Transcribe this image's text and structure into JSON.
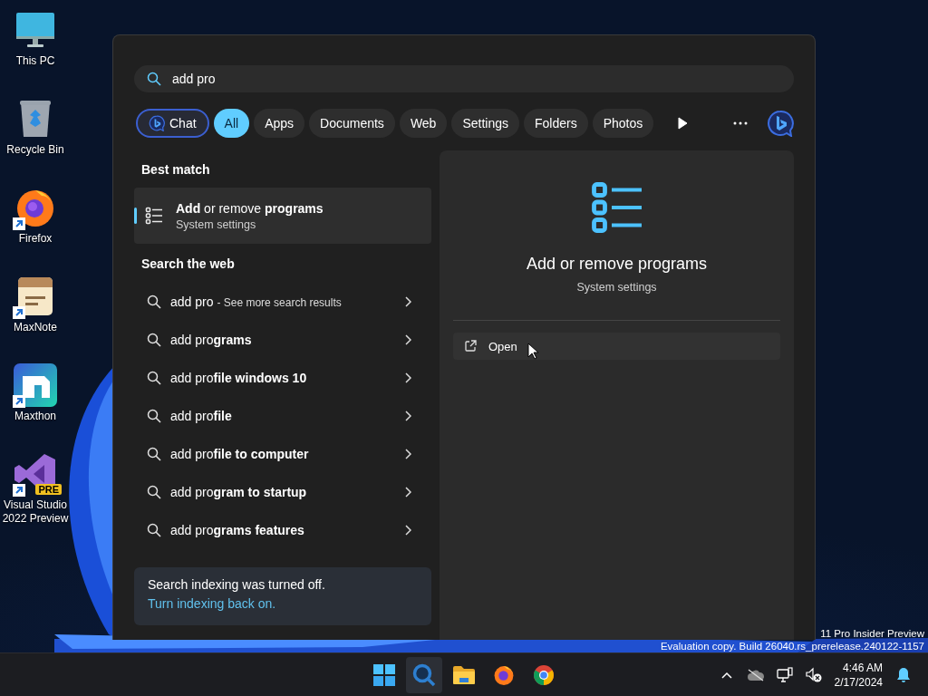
{
  "desktop": {
    "icons": [
      {
        "label": "This PC",
        "kind": "monitor",
        "shortcut": false
      },
      {
        "label": "Recycle Bin",
        "kind": "bin",
        "shortcut": false
      },
      {
        "label": "Firefox",
        "kind": "firefox",
        "shortcut": true
      },
      {
        "label": "MaxNote",
        "kind": "notepad",
        "shortcut": true
      },
      {
        "label": "Maxthon",
        "kind": "maxthon",
        "shortcut": true
      },
      {
        "label": "Visual Studio 2022 Preview",
        "kind": "vs",
        "shortcut": true,
        "badge": "PRE"
      }
    ],
    "watermark": [
      "11 Pro Insider Preview",
      "Evaluation copy. Build 26040.rs_prerelease.240122-1157"
    ]
  },
  "search": {
    "query": "add pro"
  },
  "filters": [
    {
      "label": "Chat",
      "kind": "chat",
      "selected": false
    },
    {
      "label": "All",
      "kind": "text",
      "selected": true
    },
    {
      "label": "Apps",
      "kind": "text",
      "selected": false
    },
    {
      "label": "Documents",
      "kind": "text",
      "selected": false
    },
    {
      "label": "Web",
      "kind": "text",
      "selected": false
    },
    {
      "label": "Settings",
      "kind": "text",
      "selected": false
    },
    {
      "label": "Folders",
      "kind": "text",
      "selected": false
    },
    {
      "label": "Photos",
      "kind": "text",
      "selected": false
    }
  ],
  "best_match": {
    "heading": "Best match",
    "title": "**Add** or remove **programs**",
    "subtitle": "System settings",
    "selected": true
  },
  "web": {
    "heading": "Search the web",
    "items": [
      {
        "text": "add pro",
        "hint": "- See more search results"
      },
      {
        "text": "add pro**grams**"
      },
      {
        "text": "add pro**file windows 10**"
      },
      {
        "text": "add pro**file**"
      },
      {
        "text": "add pro**file to computer**"
      },
      {
        "text": "add pro**gram to startup**"
      },
      {
        "text": "add pro**grams features**"
      }
    ]
  },
  "notice": {
    "text": "Search indexing was turned off.",
    "link": "Turn indexing back on."
  },
  "preview": {
    "title": "Add or remove programs",
    "subtitle": "System settings",
    "actions": [
      {
        "label": "Open"
      }
    ]
  },
  "taskbar": {
    "apps": [
      {
        "kind": "start",
        "active": false
      },
      {
        "kind": "search",
        "active": true
      },
      {
        "kind": "folder",
        "active": false
      },
      {
        "kind": "firefox",
        "active": false
      },
      {
        "kind": "chrome",
        "active": false
      }
    ],
    "time": "4:46 AM",
    "date": "2/17/2024"
  }
}
